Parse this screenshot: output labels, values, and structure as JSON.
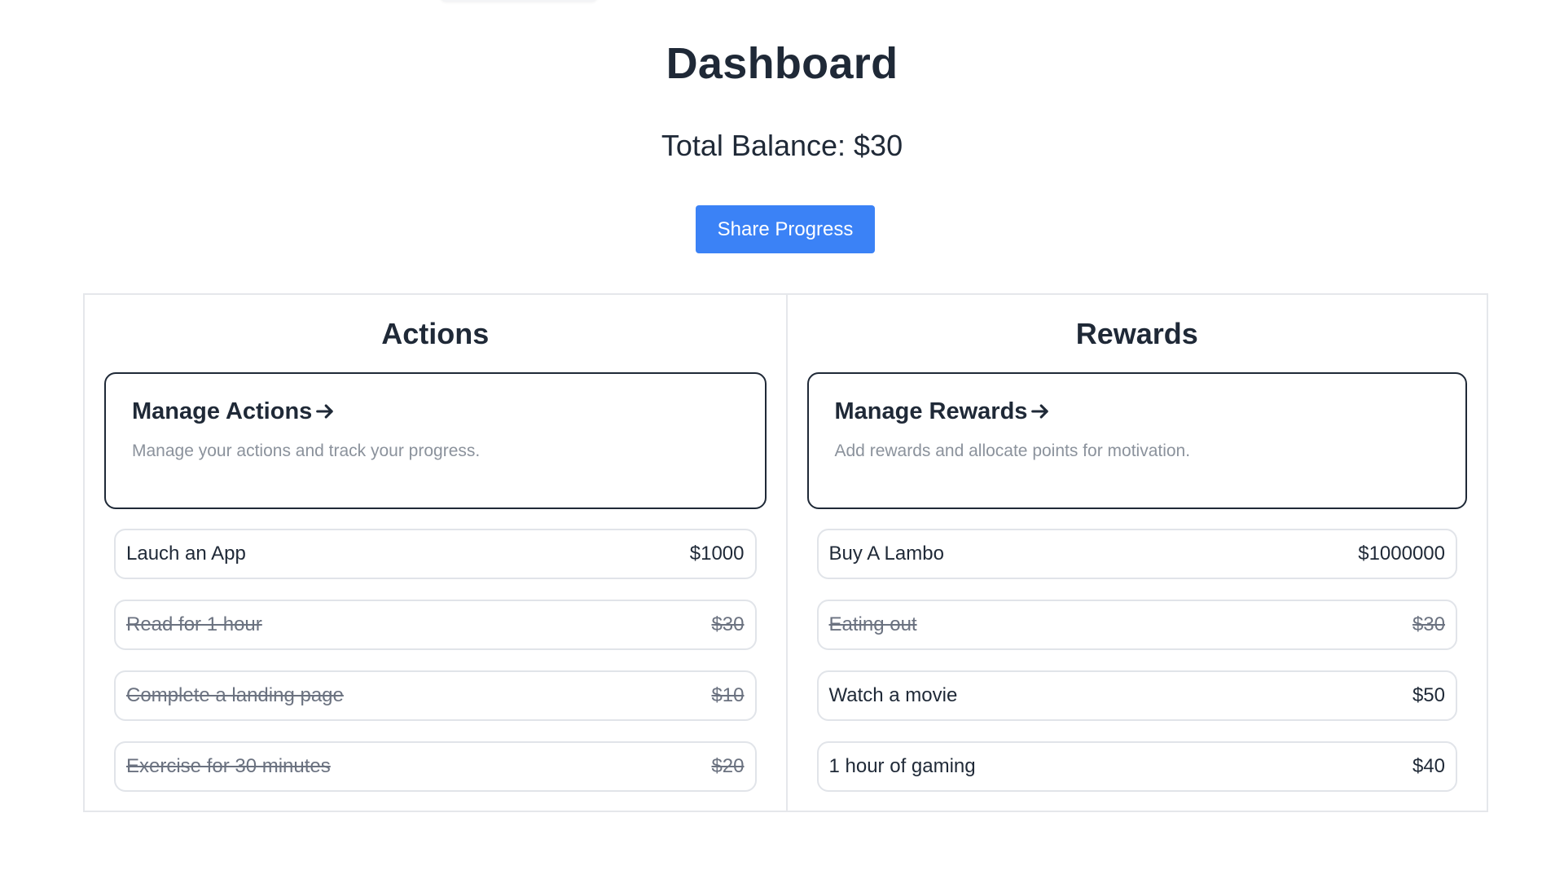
{
  "header": {
    "title": "Dashboard",
    "balance_label": "Total Balance: $30",
    "share_button": "Share Progress"
  },
  "colors": {
    "accent": "#3b82f6",
    "text": "#1f2937",
    "muted": "#8b929c",
    "completed": "#6b7280",
    "border": "#e5e7eb"
  },
  "actions": {
    "title": "Actions",
    "card": {
      "title": "Manage Actions",
      "icon": "arrow-right-icon",
      "description": "Manage your actions and track your progress."
    },
    "items": [
      {
        "name": "Lauch an App",
        "amount": "$1000",
        "completed": false
      },
      {
        "name": "Read for 1 hour",
        "amount": "$30",
        "completed": true
      },
      {
        "name": "Complete a landing page",
        "amount": "$10",
        "completed": true
      },
      {
        "name": "Exercise for 30 minutes",
        "amount": "$20",
        "completed": true
      }
    ]
  },
  "rewards": {
    "title": "Rewards",
    "card": {
      "title": "Manage Rewards",
      "icon": "arrow-right-icon",
      "description": "Add rewards and allocate points for motivation."
    },
    "items": [
      {
        "name": "Buy A Lambo",
        "amount": "$1000000",
        "completed": false
      },
      {
        "name": "Eating out",
        "amount": "$30",
        "completed": true
      },
      {
        "name": "Watch a movie",
        "amount": "$50",
        "completed": false
      },
      {
        "name": "1 hour of gaming",
        "amount": "$40",
        "completed": false
      }
    ]
  }
}
